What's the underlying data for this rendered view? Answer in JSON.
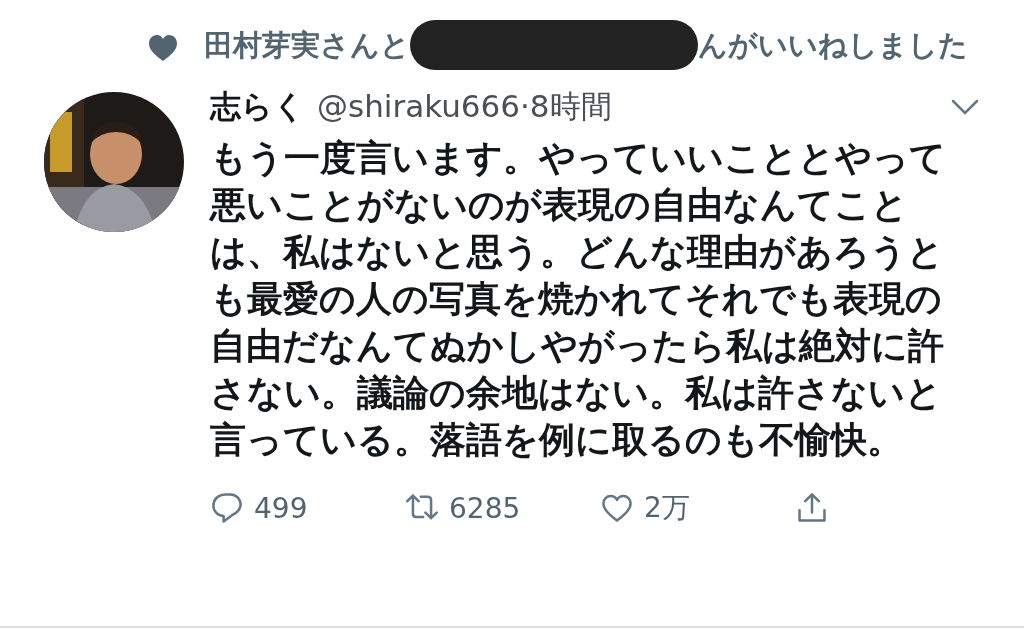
{
  "social_context": {
    "before": "田村芽実さんと",
    "after": "んがいいねしました"
  },
  "tweet": {
    "display_name": "志らく",
    "handle": "@shiraku666",
    "separator": "·",
    "time": "8時間",
    "text": "もう一度言います。やっていいこととやって悪いことがないのが表現の自由なんてことは、私はないと思う。どんな理由があろうとも最愛の人の写真を焼かれてそれでも表現の自由だなんてぬかしやがったら私は絶対に許さない。議論の余地はない。私は許さないと言っている。落語を例に取るのも不愉快。",
    "actions": [
      {
        "kind": "reply",
        "count": "499"
      },
      {
        "kind": "retweet",
        "count": "6285"
      },
      {
        "kind": "like",
        "count": "2万"
      },
      {
        "kind": "share"
      }
    ]
  }
}
